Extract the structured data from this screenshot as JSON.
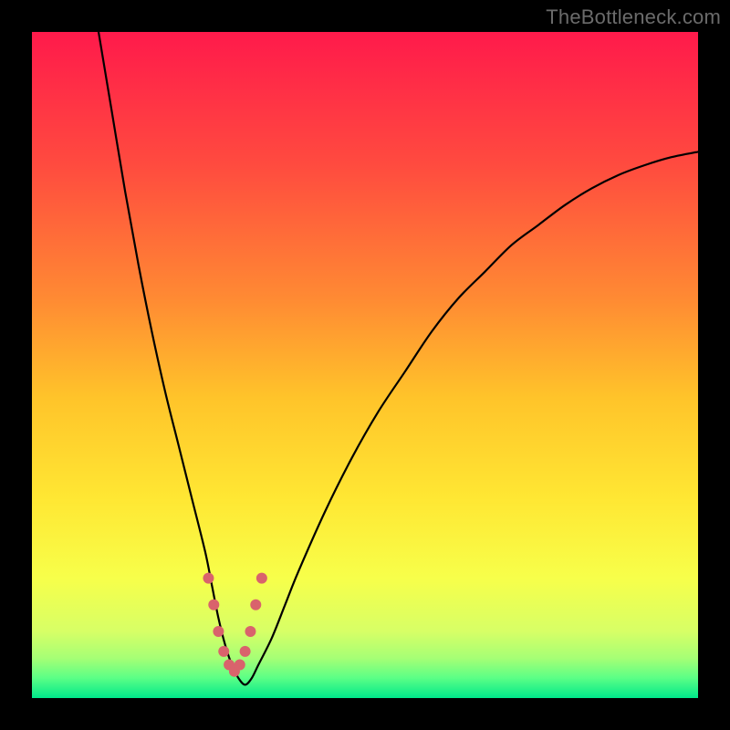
{
  "watermark": "TheBottleneck.com",
  "chart_data": {
    "type": "line",
    "title": "",
    "xlabel": "",
    "ylabel": "",
    "xlim": [
      0,
      100
    ],
    "ylim": [
      0,
      100
    ],
    "grid": false,
    "legend": false,
    "background_gradient": {
      "stops": [
        {
          "pos": 0.0,
          "color": "#ff1a4b"
        },
        {
          "pos": 0.2,
          "color": "#ff4b3f"
        },
        {
          "pos": 0.4,
          "color": "#ff8a33"
        },
        {
          "pos": 0.55,
          "color": "#ffc42a"
        },
        {
          "pos": 0.7,
          "color": "#ffe733"
        },
        {
          "pos": 0.82,
          "color": "#f7ff4a"
        },
        {
          "pos": 0.9,
          "color": "#d7ff66"
        },
        {
          "pos": 0.94,
          "color": "#a6ff75"
        },
        {
          "pos": 0.97,
          "color": "#5bff86"
        },
        {
          "pos": 1.0,
          "color": "#00e88a"
        }
      ]
    },
    "series": [
      {
        "name": "bottleneck-curve",
        "color": "#000000",
        "width": 2.2,
        "x": [
          10,
          12,
          14,
          16,
          18,
          20,
          22,
          24,
          26,
          27,
          28,
          29,
          30,
          31,
          32,
          33,
          34,
          36,
          38,
          40,
          44,
          48,
          52,
          56,
          60,
          64,
          68,
          72,
          76,
          80,
          84,
          88,
          92,
          96,
          100
        ],
        "y": [
          100,
          88,
          76,
          65,
          55,
          46,
          38,
          30,
          22,
          17,
          12,
          8,
          5,
          3,
          2,
          3,
          5,
          9,
          14,
          19,
          28,
          36,
          43,
          49,
          55,
          60,
          64,
          68,
          71,
          74,
          76.5,
          78.5,
          80,
          81.2,
          82
        ]
      }
    ],
    "markers": [
      {
        "name": "min-region-dots",
        "color": "#d9636c",
        "radius": 6,
        "x": [
          26.5,
          27.3,
          28.0,
          28.8,
          29.6,
          30.4,
          31.2,
          32.0,
          32.8,
          33.6,
          34.5
        ],
        "y": [
          18,
          14,
          10,
          7,
          5,
          4,
          5,
          7,
          10,
          14,
          18
        ]
      }
    ]
  }
}
